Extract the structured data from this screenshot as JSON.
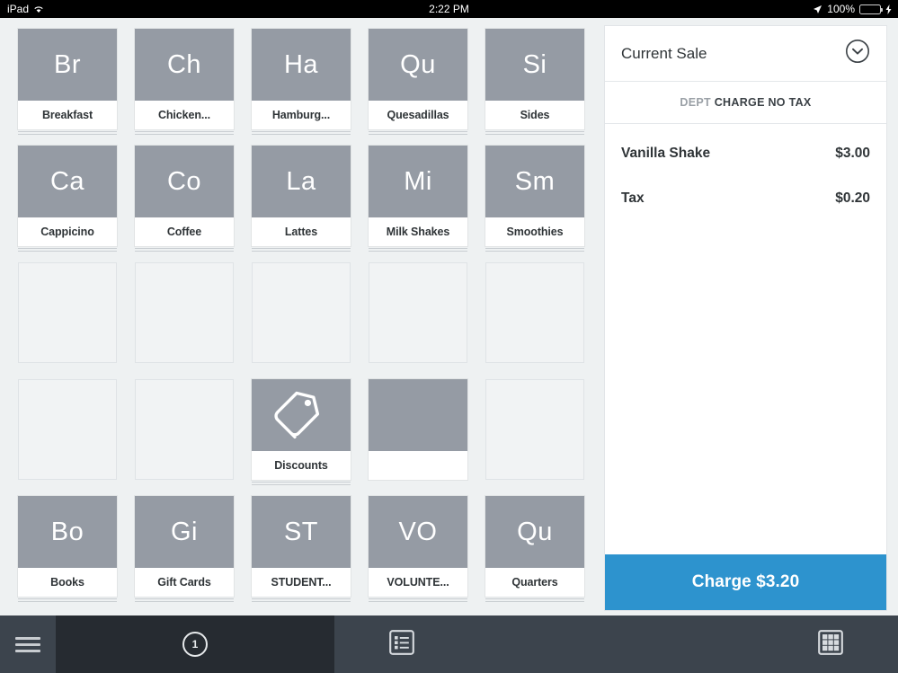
{
  "status_bar": {
    "device": "iPad",
    "wifi_icon": "wifi-icon",
    "time": "2:22 PM",
    "location_icon": "location-arrow-icon",
    "battery_percent": "100%",
    "battery_color": "#4cd964",
    "charging_icon": "lightning-bolt-icon"
  },
  "grid": {
    "rows": [
      [
        {
          "abbr": "Br",
          "label": "Breakfast",
          "state": "filled"
        },
        {
          "abbr": "Ch",
          "label": "Chicken...",
          "state": "filled"
        },
        {
          "abbr": "Ha",
          "label": "Hamburg...",
          "state": "filled"
        },
        {
          "abbr": "Qu",
          "label": "Quesadillas",
          "state": "filled"
        },
        {
          "abbr": "Si",
          "label": "Sides",
          "state": "filled"
        }
      ],
      [
        {
          "abbr": "Ca",
          "label": "Cappicino",
          "state": "filled"
        },
        {
          "abbr": "Co",
          "label": "Coffee",
          "state": "filled"
        },
        {
          "abbr": "La",
          "label": "Lattes",
          "state": "filled"
        },
        {
          "abbr": "Mi",
          "label": "Milk Shakes",
          "state": "filled"
        },
        {
          "abbr": "Sm",
          "label": "Smoothies",
          "state": "filled"
        }
      ],
      [
        {
          "abbr": "",
          "label": "",
          "state": "empty"
        },
        {
          "abbr": "",
          "label": "",
          "state": "empty"
        },
        {
          "abbr": "",
          "label": "",
          "state": "empty"
        },
        {
          "abbr": "",
          "label": "",
          "state": "empty"
        },
        {
          "abbr": "",
          "label": "",
          "state": "empty"
        }
      ],
      [
        {
          "abbr": "",
          "label": "",
          "state": "empty"
        },
        {
          "abbr": "",
          "label": "",
          "state": "empty"
        },
        {
          "abbr": "",
          "label": "Discounts",
          "state": "icon",
          "icon": "price-tag-icon"
        },
        {
          "abbr": "",
          "label": "",
          "state": "blank-label"
        },
        {
          "abbr": "",
          "label": "",
          "state": "empty"
        }
      ],
      [
        {
          "abbr": "Bo",
          "label": "Books",
          "state": "filled"
        },
        {
          "abbr": "Gi",
          "label": "Gift Cards",
          "state": "filled"
        },
        {
          "abbr": "ST",
          "label": "STUDENT...",
          "state": "filled"
        },
        {
          "abbr": "VO",
          "label": "VOLUNTE...",
          "state": "filled"
        },
        {
          "abbr": "Qu",
          "label": "Quarters",
          "state": "filled"
        }
      ]
    ],
    "tile_color": "#959ba4"
  },
  "panel": {
    "title": "Current Sale",
    "collapse_icon": "chevron-down-circle-icon",
    "dept_prefix": "DEPT",
    "dept_name": "CHARGE NO TAX",
    "items": [
      {
        "name": "Vanilla Shake",
        "price": "$3.00"
      },
      {
        "name": "Tax",
        "price": "$0.20"
      }
    ],
    "charge_label": "Charge $3.20",
    "charge_color": "#2d93ce"
  },
  "toolbar": {
    "menu_icon": "hamburger-menu-icon",
    "active_tab_badge": "1",
    "list_view_icon": "list-view-icon",
    "grid_view_icon": "grid-view-icon",
    "background": "#3c444d",
    "active_background": "#262b31"
  }
}
